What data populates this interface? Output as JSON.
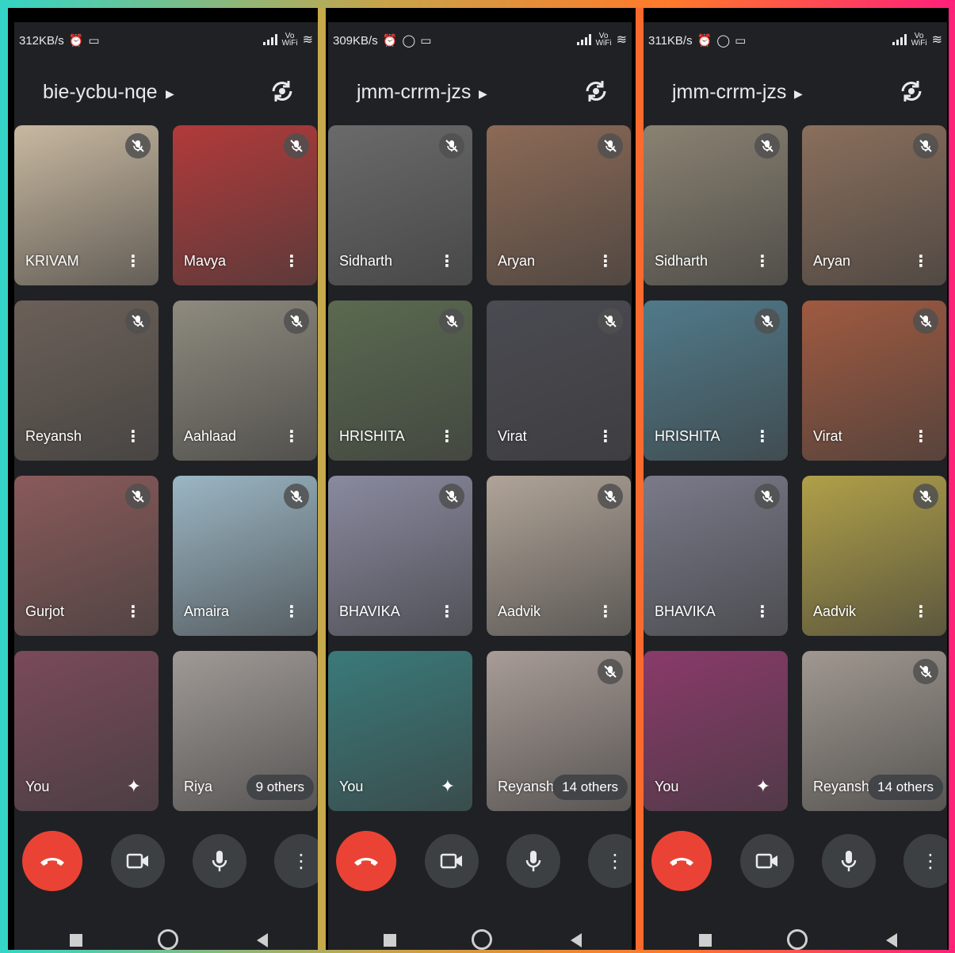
{
  "colors": {
    "panel_bg": "#202124",
    "end_call": "#ea4335",
    "control_bg": "#3c4043"
  },
  "panels": [
    {
      "status": {
        "speed": "312KB/s",
        "vo": "Vo",
        "wifi": "WiFi"
      },
      "room": "bie-ycbu-nqe",
      "tiles": [
        {
          "name": "KRIVAM",
          "muted": true,
          "bg": "#c8b8a0"
        },
        {
          "name": "Mavya",
          "muted": true,
          "bg": "#b23a3a"
        },
        {
          "name": "Reyansh",
          "muted": true,
          "bg": "#6b6058"
        },
        {
          "name": "Aahlaad",
          "muted": true,
          "bg": "#8e8a7e"
        },
        {
          "name": "Gurjot",
          "muted": true,
          "bg": "#8a5a5a"
        },
        {
          "name": "Amaira",
          "muted": true,
          "bg": "#9bb6c4"
        },
        {
          "name": "You",
          "muted": false,
          "self": true,
          "bg": "#7a4a5a"
        },
        {
          "name": "Riya",
          "muted": false,
          "bg": "#a09a96",
          "others": "9 others"
        }
      ]
    },
    {
      "status": {
        "speed": "309KB/s",
        "vo": "Vo",
        "wifi": "WiFi"
      },
      "room": "jmm-crrm-jzs",
      "tiles": [
        {
          "name": "Sidharth",
          "muted": true,
          "bg": "#6a6a6a"
        },
        {
          "name": "Aryan",
          "muted": true,
          "bg": "#8c6a56"
        },
        {
          "name": "HRISHITA",
          "muted": true,
          "bg": "#5a6a50"
        },
        {
          "name": "Virat",
          "muted": true,
          "bg": "#4a4a52"
        },
        {
          "name": "BHAVIKA",
          "muted": true,
          "bg": "#8a8aa0"
        },
        {
          "name": "Aadvik",
          "muted": true,
          "bg": "#b0a498"
        },
        {
          "name": "You",
          "muted": false,
          "self": true,
          "bg": "#3a7a7a"
        },
        {
          "name": "Reyansh",
          "muted": true,
          "bg": "#a89c96",
          "others": "14 others"
        }
      ]
    },
    {
      "status": {
        "speed": "311KB/s",
        "vo": "Vo",
        "wifi": "WiFi"
      },
      "room": "jmm-crrm-jzs",
      "tiles": [
        {
          "name": "Sidharth",
          "muted": true,
          "bg": "#8a8272"
        },
        {
          "name": "Aryan",
          "muted": true,
          "bg": "#8a6f5c"
        },
        {
          "name": "HRISHITA",
          "muted": true,
          "bg": "#507a8a"
        },
        {
          "name": "Virat",
          "muted": true,
          "bg": "#a05a40"
        },
        {
          "name": "BHAVIKA",
          "muted": true,
          "bg": "#7a7a8a"
        },
        {
          "name": "Aadvik",
          "muted": true,
          "bg": "#b0a048"
        },
        {
          "name": "You",
          "muted": false,
          "self": true,
          "bg": "#8a3a6a"
        },
        {
          "name": "Reyansh",
          "muted": true,
          "bg": "#a09890",
          "others": "14 others"
        }
      ]
    }
  ]
}
